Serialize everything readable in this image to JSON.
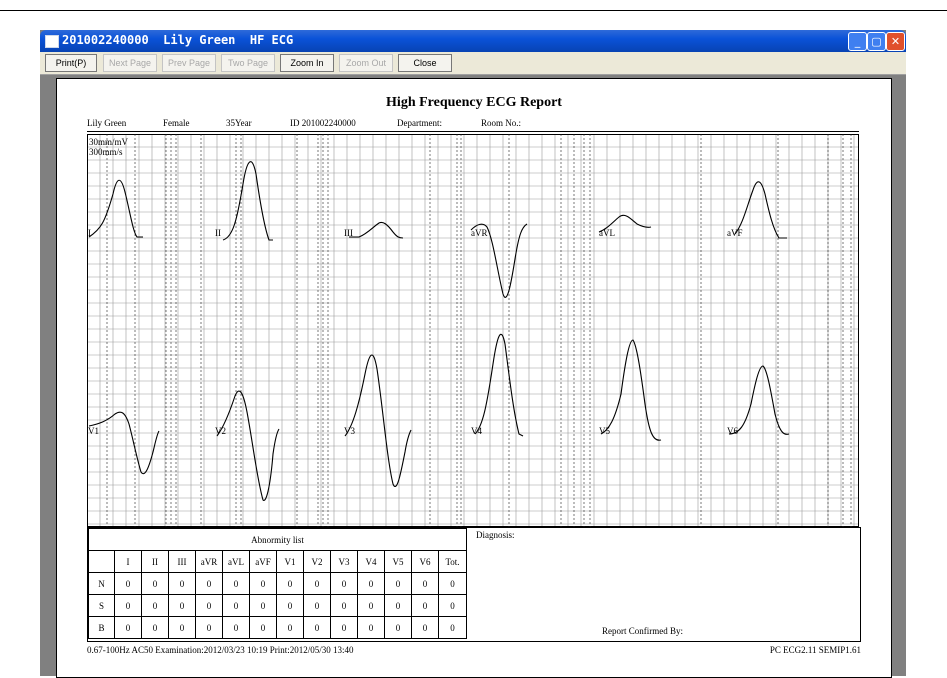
{
  "window": {
    "title": "201002240000  Lily Green  HF ECG",
    "buttons": {
      "minimize": "_",
      "maximize": "▢",
      "close": "✕"
    }
  },
  "toolbar": {
    "print": "Print(P)",
    "next_page": "Next Page",
    "prev_page": "Prev Page",
    "two_page": "Two Page",
    "zoom_in": "Zoom In",
    "zoom_out": "Zoom Out",
    "close": "Close"
  },
  "report": {
    "title": "High Frequency ECG Report",
    "patient": {
      "name": "Lily Green",
      "sex": "Female",
      "age": "35Year",
      "id": "ID 201002240000",
      "department": "Department:",
      "room": "Room No.:"
    },
    "scale": {
      "amplitude": "30mm/mV",
      "speed": "300mm/s"
    },
    "leads_row1": [
      "I",
      "II",
      "III",
      "aVR",
      "aVL",
      "aVF"
    ],
    "leads_row2": [
      "V1",
      "V2",
      "V3",
      "V4",
      "V5",
      "V6"
    ],
    "abnormity": {
      "title": "Abnormity list",
      "columns": [
        "I",
        "II",
        "III",
        "aVR",
        "aVL",
        "aVF",
        "V1",
        "V2",
        "V3",
        "V4",
        "V5",
        "V6",
        "Tot."
      ],
      "rows": [
        {
          "label": "N",
          "values": [
            "0",
            "0",
            "0",
            "0",
            "0",
            "0",
            "0",
            "0",
            "0",
            "0",
            "0",
            "0",
            "0"
          ]
        },
        {
          "label": "S",
          "values": [
            "0",
            "0",
            "0",
            "0",
            "0",
            "0",
            "0",
            "0",
            "0",
            "0",
            "0",
            "0",
            "0"
          ]
        },
        {
          "label": "B",
          "values": [
            "0",
            "0",
            "0",
            "0",
            "0",
            "0",
            "0",
            "0",
            "0",
            "0",
            "0",
            "0",
            "0"
          ]
        }
      ]
    },
    "diagnosis_label": "Diagnosis:",
    "confirmed_by": "Report Confirmed By:",
    "footer_left": "0.67-100Hz AC50 Examination:2012/03/23 10:19  Print:2012/05/30 13:40",
    "footer_right": "PC ECG2.11  SEMIP1.61"
  }
}
